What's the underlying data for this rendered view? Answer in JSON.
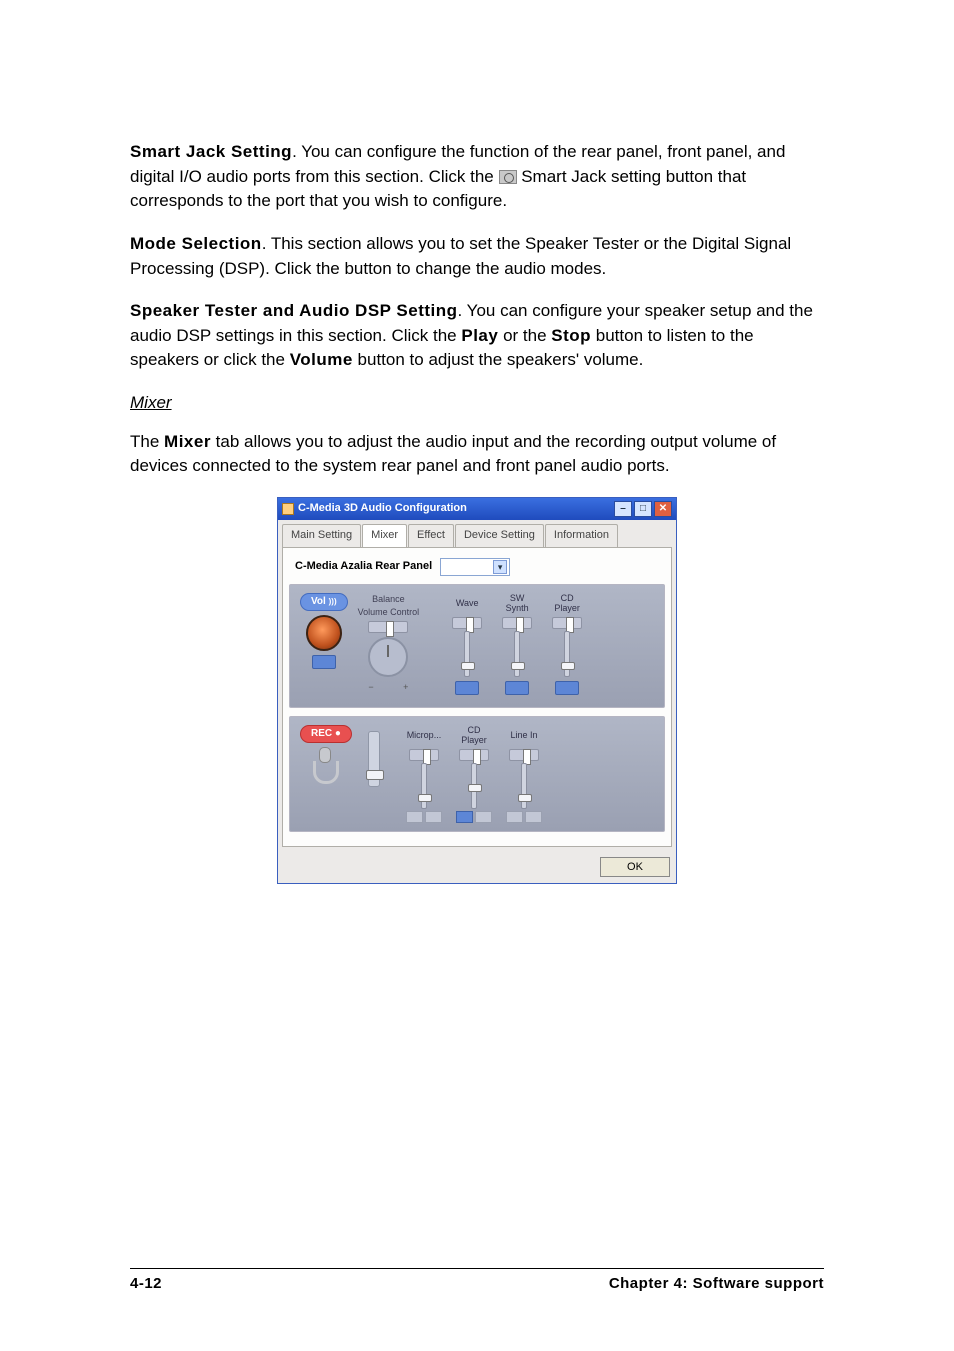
{
  "sections": {
    "smartJack": {
      "heading": "Smart Jack Setting",
      "text1": ". You can configure the function of the rear panel, front panel, and digital I/O audio ports from this section. Click the ",
      "text2": " Smart Jack setting button that corresponds to the port that you wish to configure."
    },
    "modeSel": {
      "heading": "Mode Selection",
      "text": ". This section allows you to set the Speaker Tester or the Digital Signal Processing (DSP). Click the button to change the audio modes."
    },
    "speaker": {
      "heading": "Speaker Tester and Audio DSP Setting",
      "t1": ". You can configure your speaker setup and the audio DSP settings in this section. Click the ",
      "play": "Play",
      "t2": " or the ",
      "stop": "Stop",
      "t3": " button to listen to the speakers or click the ",
      "vol": "Volume",
      "t4": " button to adjust the speakers' volume."
    },
    "mixerHeading": "Mixer",
    "mixerIntro": {
      "t1": "The ",
      "mixer": "Mixer",
      "t2": " tab allows you to adjust the audio input and the recording output volume of devices connected to the system rear panel and front panel audio ports."
    }
  },
  "window": {
    "title": "C-Media 3D Audio Configuration",
    "tabs": [
      "Main Setting",
      "Mixer",
      "Effect",
      "Device Setting",
      "Information"
    ],
    "activeTab": "Mixer",
    "selectLabel": "C-Media Azalia Rear Panel",
    "vol": {
      "badge": "Vol",
      "balance": "Balance",
      "volumeControl": "Volume Control",
      "channels": [
        {
          "label": "Wave"
        },
        {
          "label": "SW Synth"
        },
        {
          "label": "CD Player"
        }
      ]
    },
    "rec": {
      "badge": "REC",
      "channels": [
        {
          "label": "Microp..."
        },
        {
          "label": "CD Player"
        },
        {
          "label": "Line In"
        }
      ]
    },
    "ok": "OK"
  },
  "footer": {
    "left": "4-12",
    "right": "Chapter 4: Software support"
  }
}
